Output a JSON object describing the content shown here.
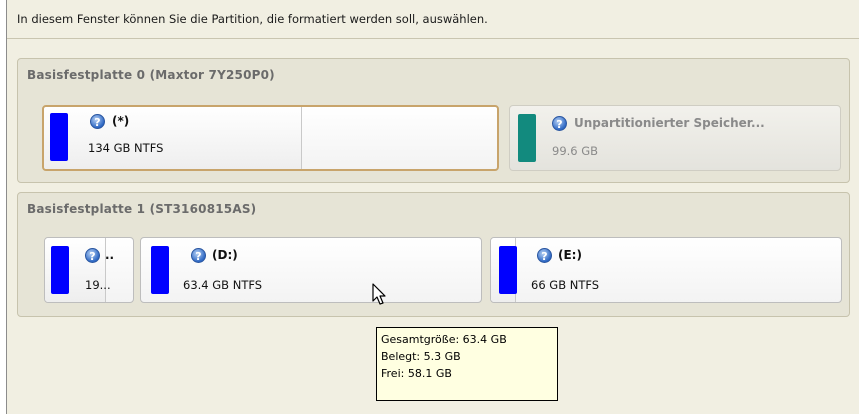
{
  "instruction": "In diesem Fenster können Sie die Partition, die formatiert werden soll, auswählen.",
  "colors": {
    "partition_blue": "#0000ff",
    "unallocated_teal": "#128a7e",
    "selection_border": "#c8a46b"
  },
  "disk0": {
    "title": "Basisfestplatte 0 (Maxtor 7Y250P0)",
    "partitions": [
      {
        "label": "(*)",
        "size": "134 GB NTFS",
        "icon": "help-icon",
        "selected": true
      },
      {
        "label": "Unpartitionierter Speicher...",
        "size": "99.6 GB",
        "icon": "help-icon",
        "unallocated": true
      }
    ]
  },
  "disk1": {
    "title": "Basisfestplatte 1 (ST3160815AS)",
    "partitions": [
      {
        "label": "..",
        "size": "19...",
        "icon": "help-icon"
      },
      {
        "label": "(D:)",
        "size": "63.4 GB NTFS",
        "icon": "help-icon"
      },
      {
        "label": "(E:)",
        "size": "66 GB NTFS",
        "icon": "help-icon"
      }
    ]
  },
  "tooltip": {
    "total": "Gesamtgröße: 63.4 GB",
    "used": "Belegt: 5.3 GB",
    "free": "Frei: 58.1 GB"
  }
}
